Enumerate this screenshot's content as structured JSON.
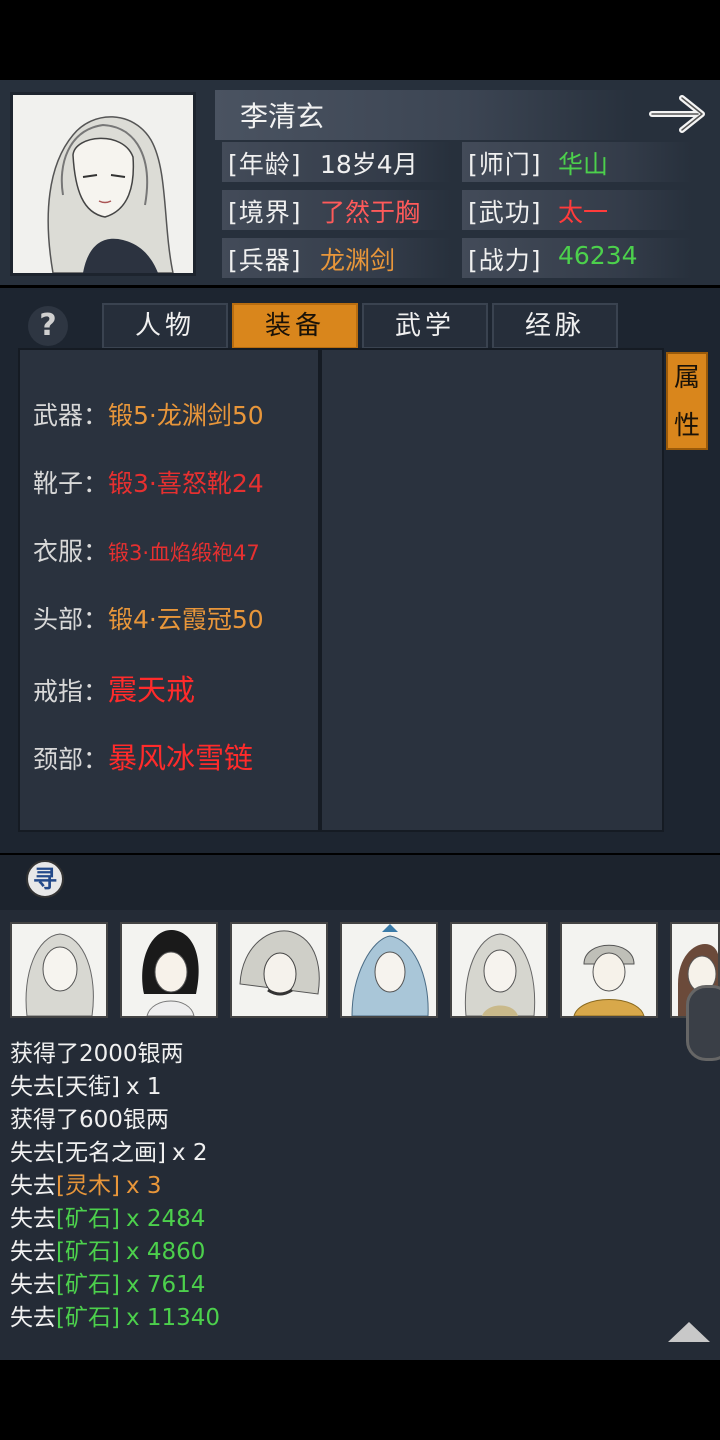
{
  "character": {
    "name": "李清玄",
    "stats": [
      {
        "label": "[年龄]",
        "value": "18岁4月",
        "color": "#f0f0f0"
      },
      {
        "label": "[师门]",
        "value": "华山",
        "color": "#4cd04c"
      },
      {
        "label": "[境界]",
        "value": "了然于胸",
        "color": "#ff5a5a"
      },
      {
        "label": "[武功]",
        "value": "太一",
        "color": "#ff3b3b"
      },
      {
        "label": "[兵器]",
        "value": "龙渊剑",
        "color": "#e8963a"
      },
      {
        "label": "[战力]",
        "value": "46234",
        "color": "#4cd04c"
      }
    ]
  },
  "tabs": [
    {
      "label": "人物",
      "active": false
    },
    {
      "label": "装备",
      "active": true
    },
    {
      "label": "武学",
      "active": false
    },
    {
      "label": "经脉",
      "active": false
    }
  ],
  "help_icon": "?",
  "attr_tab": "属性",
  "search_icon": "寻",
  "equipment": [
    {
      "label": "武器：",
      "value": "锻5·龙渊剑50",
      "color": "#e8963a",
      "size": 25
    },
    {
      "label": "靴子：",
      "value": "锻3·喜怒靴24",
      "color": "#e63030",
      "size": 25
    },
    {
      "label": "衣服：",
      "value": "锻3·血焰缎袍47",
      "color": "#e63030",
      "size": 21
    },
    {
      "label": "头部：",
      "value": "锻4·云霞冠50",
      "color": "#e8963a",
      "size": 25
    },
    {
      "label": "戒指：",
      "value": "震天戒",
      "color": "#ff2b2b",
      "size": 29
    },
    {
      "label": "颈部：",
      "value": "暴风冰雪链",
      "color": "#ff2b2b",
      "size": 29
    }
  ],
  "log": [
    {
      "prefix": "获得了2000银两",
      "item": "",
      "qty": "",
      "color": "#f0f0f0"
    },
    {
      "prefix": "失去",
      "item": "[天街]",
      "qty": "x 1",
      "color": "#f0f0f0"
    },
    {
      "prefix": "获得了600银两",
      "item": "",
      "qty": "",
      "color": "#f0f0f0"
    },
    {
      "prefix": "失去",
      "item": "[无名之画]",
      "qty": "x 2",
      "color": "#f0f0f0"
    },
    {
      "prefix": "失去",
      "item": "[灵木]",
      "qty": "x 3",
      "color": "#e8963a"
    },
    {
      "prefix": "失去",
      "item": "[矿石]",
      "qty": "x 2484",
      "color": "#4cd04c"
    },
    {
      "prefix": "失去",
      "item": "[矿石]",
      "qty": "x 4860",
      "color": "#4cd04c"
    },
    {
      "prefix": "失去",
      "item": "[矿石]",
      "qty": "x 7614",
      "color": "#4cd04c"
    },
    {
      "prefix": "失去",
      "item": "[矿石]",
      "qty": "x 11340",
      "color": "#4cd04c"
    }
  ],
  "colors": {
    "accent": "#d9861c",
    "panel": "#2a323e",
    "header": "#27303c"
  }
}
